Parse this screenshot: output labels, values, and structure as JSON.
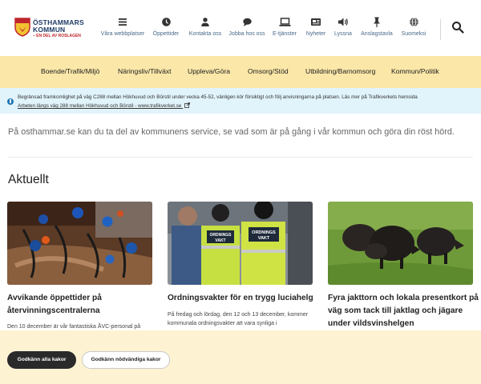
{
  "header": {
    "logo": {
      "line1": "ÖSTHAMMARS",
      "line2": "KOMMUN",
      "tagline": "– EN DEL AV ROSLAGEN"
    },
    "nav": [
      {
        "label": "Våra webbplatser",
        "icon": "menu-icon"
      },
      {
        "label": "Öppettider",
        "icon": "clock-icon"
      },
      {
        "label": "Kontakta oss",
        "icon": "person-icon"
      },
      {
        "label": "Jobba hos oss",
        "icon": "chat-bubble-icon"
      },
      {
        "label": "E-tjänster",
        "icon": "laptop-icon"
      },
      {
        "label": "Nyheter",
        "icon": "newspaper-icon"
      },
      {
        "label": "Lyssna",
        "icon": "speaker-icon"
      },
      {
        "label": "Anslagstavla",
        "icon": "pin-icon"
      },
      {
        "label": "Suomeksi",
        "icon": "globe-icon"
      }
    ],
    "search_icon": "search-icon"
  },
  "menu": [
    "Boende/Trafik/Miljö",
    "Näringsliv/Tillväxt",
    "Uppleva/Göra",
    "Omsorg/Stöd",
    "Utbildning/Barnomsorg",
    "Kommun/Politik"
  ],
  "alert": {
    "text": "Begränsad framkomlighet på väg C288 mellan Hökhuvud och Börstil under vecka 45-52, vänligen kör försiktigt och följ anvisningarna på platsen. Läs mer på Trafikverkets hemsida",
    "link": "Arbeten längs väg 288 mellan Hökhuvud och Börstil - www.trafikverket.se",
    "icon": "info-icon"
  },
  "intro": "På osthammar.se kan du ta del av kommunens service, se vad som är på gång i vår kommun och göra din röst hörd.",
  "news": {
    "title": "Aktuellt",
    "items": [
      {
        "title_lines": [
          "Avvikande öppettider på",
          "återvinningscentralerna"
        ],
        "desc_lines": [
          "Den 10 december är vår fantastiska ÅVC-personal på"
        ]
      },
      {
        "title_lines": [
          "Ordningsvakter för en trygg luciahelg"
        ],
        "desc_lines": [
          "På fredag och lördag, den 12 och 13 december, kommer",
          "kommunala ordningsvakter att vara synliga i"
        ],
        "vest_label": [
          "ORDNINGS",
          "VAKT"
        ]
      },
      {
        "title_lines": [
          "Fyra jakttorn och lokala presentkort på",
          "väg som tack till jaktlag och jägare",
          "under vildsvinshelgen"
        ],
        "desc_lines": []
      }
    ]
  },
  "cookie": {
    "accept_all": "Godkänn alla kakor",
    "accept_necessary": "Godkänn nödvändiga kakor"
  },
  "colors": {
    "menu_bg": "#fbe7a8",
    "alert_bg": "#e1f3fb",
    "cookie_bg": "#fdf3d2",
    "nav_label": "#4a6a8a",
    "brand_red": "#c0262d"
  }
}
